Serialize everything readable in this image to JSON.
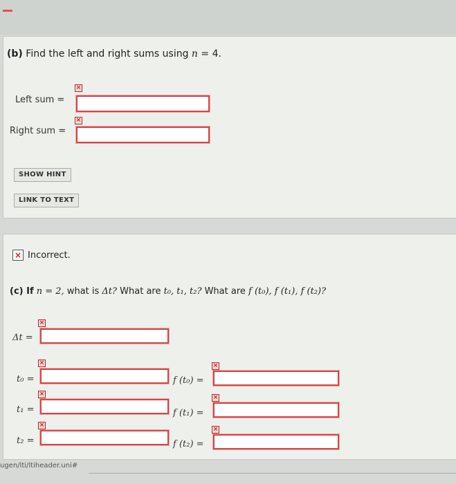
{
  "part_b": {
    "heading_prefix": "(b)",
    "heading_text": "Find the left and right sums using",
    "heading_var": "n",
    "heading_eq": "= 4.",
    "left_label": "Left sum",
    "right_label": "Right sum",
    "eq": "=",
    "show_hint": "SHOW HINT",
    "link_to_text": "LINK TO TEXT"
  },
  "status": {
    "incorrect_text": "Incorrect.",
    "mark": "×"
  },
  "part_c": {
    "prefix": "(c) If",
    "n_eq": "n = 2,",
    "q1": "what is",
    "dt": "Δt?",
    "q2": "What are",
    "ts": "t₀, t₁, t₂?",
    "q3": "What are",
    "fs": "f (t₀), f (t₁), f (t₂)?"
  },
  "fields": {
    "dt_label": "Δt =",
    "t0_label": "t₀ =",
    "t1_label": "t₁ =",
    "t2_label": "t₂ =",
    "ft0_label": "f (t₀) =",
    "ft1_label": "f (t₁) =",
    "ft2_label": "f (t₂) ="
  },
  "footer": {
    "url_fragment": "ugen/lti/ltiheader.uni#"
  },
  "colors": {
    "error_border": "#d64545",
    "panel": "#eef0ec"
  }
}
